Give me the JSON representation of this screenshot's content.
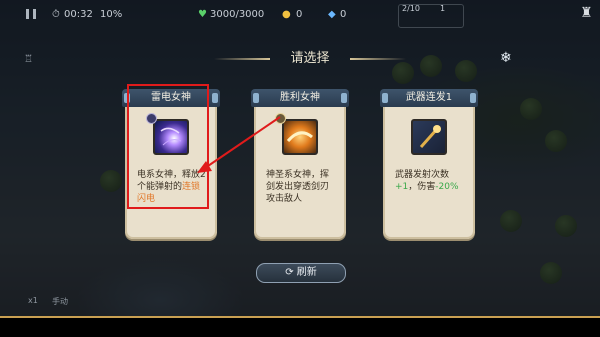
{
  "hud": {
    "timer": "00:32",
    "speed": "10%",
    "hp": "3000/3000",
    "coins": "0",
    "gems": "0",
    "wave": "2/10",
    "wave_count": "1",
    "speed_label": "x1",
    "auto_label": "手动"
  },
  "dialog": {
    "title": "请选择",
    "refresh_label": "刷新"
  },
  "cards": [
    {
      "title": "雷电女神",
      "icon": "lightning-goddess-orb-icon",
      "desc_plain": "电系女神，释放2个能弹射的",
      "desc_highlight": "连锁闪电",
      "highlight_color": "#e1782a"
    },
    {
      "title": "胜利女神",
      "icon": "victory-goddess-blade-icon",
      "desc_plain": "神圣系女神，挥剑发出穿透剑刃攻击敌人",
      "desc_highlight": "",
      "highlight_color": ""
    },
    {
      "title": "武器连发1",
      "icon": "weapon-staff-icon",
      "desc_plain": "武器发射次数",
      "desc_highlight": "+1",
      "desc_mid": "，伤害",
      "desc_highlight2": "-20%",
      "highlight_color": "#3aa84a"
    }
  ],
  "colors": {
    "annotation_red": "#e01b1b",
    "card_bg": "#e9e0cc",
    "card_header": "#2f4257"
  }
}
